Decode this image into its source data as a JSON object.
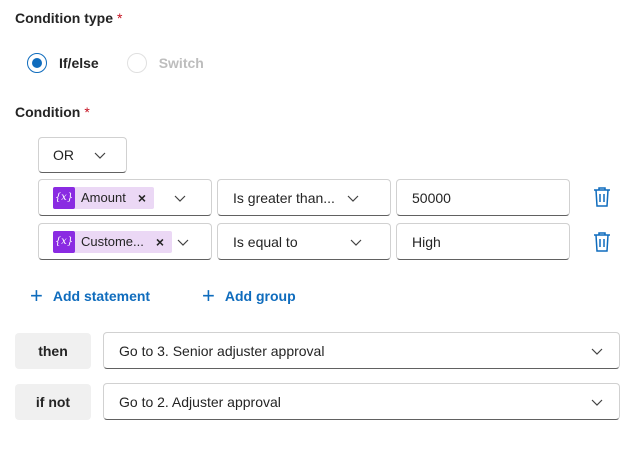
{
  "condition_type": {
    "label": "Condition type",
    "required_mark": "*",
    "options": [
      {
        "label": "If/else",
        "selected": true
      },
      {
        "label": "Switch",
        "selected": false
      }
    ]
  },
  "condition": {
    "label": "Condition",
    "required_mark": "*",
    "logic_operator": "OR",
    "rows": [
      {
        "variable": "Amount",
        "variable_icon": "{x}",
        "remove": "×",
        "operator": "Is greater than...",
        "value": "50000"
      },
      {
        "variable": "Custome...",
        "variable_icon": "{x}",
        "remove": "×",
        "operator": "Is equal to",
        "value": "High"
      }
    ],
    "add_statement": "Add statement",
    "add_group": "Add group",
    "plus": "+"
  },
  "branches": {
    "then_label": "then",
    "then_value": "Go to 3. Senior adjuster approval",
    "else_label": "if not",
    "else_value": "Go to 2. Adjuster approval"
  },
  "colors": {
    "accent": "#0f6cbd",
    "required": "#c50f1f",
    "token_bg": "#ebd8f5",
    "token_icon": "#8a2be2"
  }
}
